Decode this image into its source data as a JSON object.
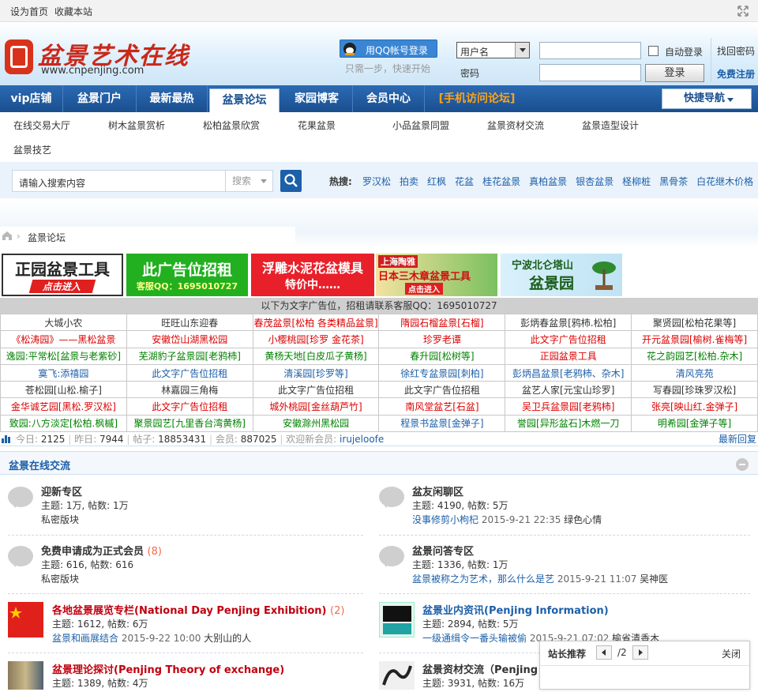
{
  "topbar": {
    "set_home": "设为首页",
    "bookmark": "收藏本站"
  },
  "header": {
    "logo_text": "盆景艺术在线",
    "logo_url": "www.cnpenjing.com",
    "qq_login": "用QQ帐号登录",
    "qq_hint": "只需一步，快速开始",
    "username_select": "用户名",
    "password_label": "密码",
    "auto_login": "自动登录",
    "login_button": "登录",
    "forgot": "找回密码",
    "register": "免费注册"
  },
  "nav": {
    "items": [
      "vip店铺",
      "盆景门户",
      "最新最热",
      "盆景论坛",
      "家园博客",
      "会员中心",
      "[手机访问论坛]"
    ],
    "quick_nav": "快捷导航"
  },
  "subnav": {
    "items": [
      "在线交易大厅",
      "树木盆景赏析",
      "松柏盆景欣赏",
      "花果盆景",
      "小品盆景同盟",
      "盆景资材交流",
      "盆景造型设计",
      "盆景技艺"
    ]
  },
  "search": {
    "placeholder": "请输入搜索内容",
    "scope": "搜索",
    "hot_label": "热搜:",
    "hot": [
      "罗汉松",
      "拍卖",
      "红枫",
      "花盆",
      "桂花盆景",
      "真柏盆景",
      "银杏盆景",
      "柽柳桩",
      "黑骨茶",
      "白花继木价格"
    ]
  },
  "breadcrumb": {
    "current": "盆景论坛"
  },
  "ads": {
    "a1_line1": "正园盆景工具",
    "a1_line2": "点击进入",
    "a2_line1": "此广告位招租",
    "a2_line2": "客服QQ：1695010727",
    "a3_line1": "浮雕水泥花盆模具",
    "a3_line2": "特价中……",
    "a4_line0": "上海陶雅",
    "a4_line1": "日本三木章盆景工具",
    "a4_line2": "点击进入",
    "a5_line1": "宁波北仑塔山",
    "a5_line2": "盆景园"
  },
  "text_ads": {
    "header": "以下为文字广告位，招租请联系客服QQ：1695010727",
    "rows": [
      [
        "大城小农",
        "旺旺山东迎春",
        "春茂盆景[松柏 各类精品盆景]",
        "隋园石榴盆景[石榴]",
        "彭炳春盆景[鸦柿.松柏]",
        "聚贤园[松柏花果等]"
      ],
      [
        "《松涛园》——黑松盆景",
        "安徽岱山湖黑松园",
        "小樱桃园[珍罗 金花茶]",
        "珍罗老谭",
        "此文字广告位招租",
        "开元盆景园[榆树.雀梅等]"
      ],
      [
        "逸园:平常松[盆景与老紫砂]",
        "芜湖豹子盆景园[老鸦柿]",
        "黄杨天地[白皮瓜子黄杨]",
        "春升园[松树等]",
        "正园盆景工具",
        "花之韵园艺[松柏.杂木]"
      ],
      [
        "寞飞:添禧园",
        "此文字广告位招租",
        "清溪园[珍罗等]",
        "徐红专盆景园[刺柏]",
        "彭炳昌盆景[老鸦柿、杂木]",
        "清风亮苑"
      ],
      [
        "苍松园[山松.榆子]",
        "林嘉园三角梅",
        "此文字广告位招租",
        "此文字广告位招租",
        "盆艺人家[元宝山珍罗]",
        "写春园[珍珠罗汉松]"
      ],
      [
        "金华诚艺园[黑松.罗汉松]",
        "此文字广告位招租",
        "城外桃园[金丝葫芦竹]",
        "南风堂盆艺[石盆]",
        "吴卫兵盆景园[老鸦柿]",
        "张亮[映山红.金弹子]"
      ],
      [
        "致园:八方淡定[松柏.枫槭]",
        "聚景园艺[九里香台湾黄杨]",
        "安徽滁州黑松园",
        "程景书盆景[金弹子]",
        "誉园[异形盆石]木燃一刀",
        "明希园[金弹子等]"
      ]
    ],
    "colors": [
      [
        "#333333",
        "#333333",
        "#dd0000",
        "#dd0000",
        "#333333",
        "#333333"
      ],
      [
        "#dd0000",
        "#dd0000",
        "#dd0000",
        "#dd0000",
        "#dd0000",
        "#dd0000"
      ],
      [
        "#008000",
        "#008000",
        "#008000",
        "#008000",
        "#dd0000",
        "#008000"
      ],
      [
        "#1d5fa8",
        "#1d5fa8",
        "#1d5fa8",
        "#1d5fa8",
        "#1d5fa8",
        "#1d5fa8"
      ],
      [
        "#333333",
        "#333333",
        "#333333",
        "#333333",
        "#333333",
        "#333333"
      ],
      [
        "#dd0000",
        "#dd0000",
        "#dd0000",
        "#dd0000",
        "#dd0000",
        "#dd0000"
      ],
      [
        "#008000",
        "#008000",
        "#008000",
        "#1d5fa8",
        "#008000",
        "#008000"
      ]
    ]
  },
  "stats": {
    "today_label": "今日:",
    "today": "2125",
    "yesterday_label": "昨日:",
    "yesterday": "7944",
    "posts_label": "帖子:",
    "posts": "18853431",
    "members_label": "会员:",
    "members": "887025",
    "welcome_label": "欢迎新会员:",
    "newest": "irujeloofe",
    "latest_reply": "最新回复"
  },
  "section": {
    "title": "盆景在线交流"
  },
  "forums": [
    {
      "name": "迎新专区",
      "line1": "主题: 1万, 帖数: 1万",
      "line2": "私密版块"
    },
    {
      "name": "盆友闲聊区",
      "line1": "主题: 4190, 帖数: 5万",
      "last_title": "没事修剪小枸杞",
      "last_time": "2015-9-21 22:35",
      "last_user": "绿色心情"
    },
    {
      "name": "免费申请成为正式会员",
      "count": "(8)",
      "line1": "主题: 616, 帖数: 616",
      "line2": "私密版块"
    },
    {
      "name": "盆景问答专区",
      "line1": "主题: 1336, 帖数: 1万",
      "last_title": "盆景被称之为艺术，那么什么是艺",
      "last_time": "2015-9-21 11:07",
      "last_user": "吴神医"
    },
    {
      "name": "各地盆景展览专栏(National Day Penjing Exhibition)",
      "count": "(2)",
      "line1": "主题: 1612, 帖数: 6万",
      "last_title": "盆景和画展结合",
      "last_time": "2015-9-22 10:00",
      "last_user": "大别山的人"
    },
    {
      "name": "盆景业内资讯(Penjing Information)",
      "line1": "主题: 2894, 帖数: 5万",
      "last_title": "一级通缉令一番头输被偷",
      "last_time": "2015-9-21 07:02",
      "last_user": "榆省清香木"
    },
    {
      "name": "盆景理论探讨(Penjing Theory of exchange)",
      "line1": "主题: 1389, 帖数: 4万"
    },
    {
      "name": "盆景资材交流（Penjing a",
      "line1": "主题: 3931, 帖数: 16万"
    }
  ],
  "popup": {
    "title": "站长推荐",
    "page": "/2",
    "close": "关闭"
  }
}
